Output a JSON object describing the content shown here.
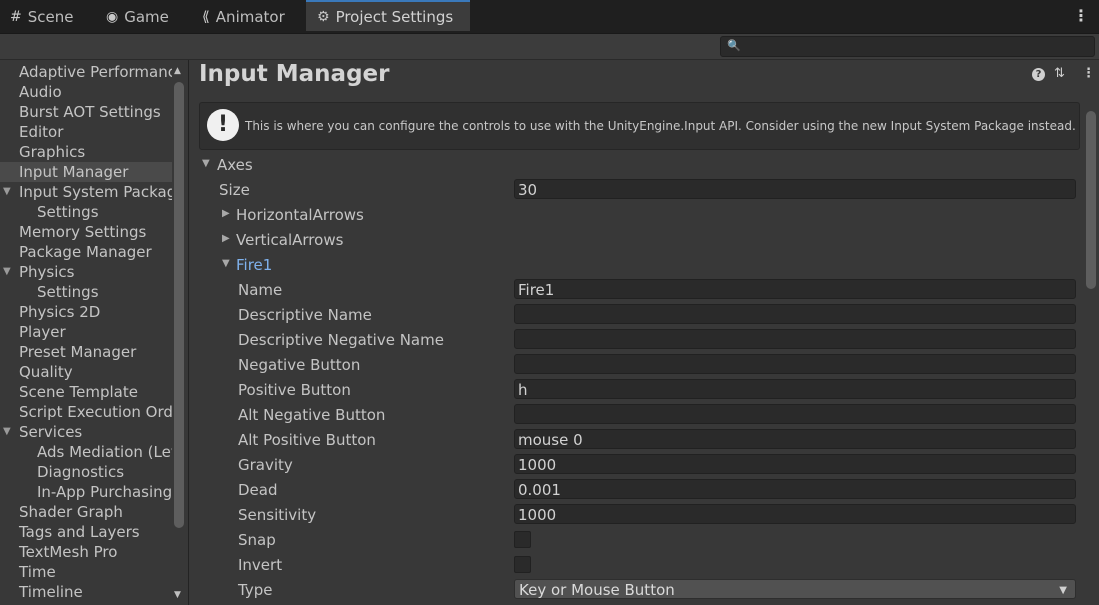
{
  "tabs": [
    {
      "label": "Scene",
      "icon": "grid-icon"
    },
    {
      "label": "Game",
      "icon": "gamepad-icon"
    },
    {
      "label": "Animator",
      "icon": "animator-icon"
    },
    {
      "label": "Project Settings",
      "icon": "gear-icon"
    }
  ],
  "search": {
    "placeholder": "",
    "value": ""
  },
  "sidebar": {
    "items": [
      {
        "label": "Adaptive Performance"
      },
      {
        "label": "Audio"
      },
      {
        "label": "Burst AOT Settings"
      },
      {
        "label": "Editor"
      },
      {
        "label": "Graphics"
      },
      {
        "label": "Input Manager",
        "selected": true
      },
      {
        "label": "Input System Package",
        "expanded": true
      },
      {
        "label": "Settings"
      },
      {
        "label": "Memory Settings"
      },
      {
        "label": "Package Manager"
      },
      {
        "label": "Physics",
        "expanded": true
      },
      {
        "label": "Settings"
      },
      {
        "label": "Physics 2D"
      },
      {
        "label": "Player"
      },
      {
        "label": "Preset Manager"
      },
      {
        "label": "Quality"
      },
      {
        "label": "Scene Template"
      },
      {
        "label": "Script Execution Order"
      },
      {
        "label": "Services",
        "expanded": true
      },
      {
        "label": "Ads Mediation (LevelPlay)"
      },
      {
        "label": "Diagnostics"
      },
      {
        "label": "In-App Purchasing"
      },
      {
        "label": "Shader Graph"
      },
      {
        "label": "Tags and Layers"
      },
      {
        "label": "TextMesh Pro"
      },
      {
        "label": "Time"
      },
      {
        "label": "Timeline"
      }
    ]
  },
  "main": {
    "title": "Input Manager",
    "notice": "This is where you can configure the controls to use with the UnityEngine.Input API. Consider using the new Input System Package instead.",
    "axes_label": "Axes",
    "size_label": "Size",
    "size_value": "30",
    "children": [
      "HorizontalArrows",
      "VerticalArrows"
    ],
    "fire1": {
      "label": "Fire1",
      "fields": [
        {
          "label": "Name",
          "value": "Fire1"
        },
        {
          "label": "Descriptive Name",
          "value": ""
        },
        {
          "label": "Descriptive Negative Name",
          "value": ""
        },
        {
          "label": "Negative Button",
          "value": ""
        },
        {
          "label": "Positive Button",
          "value": "h"
        },
        {
          "label": "Alt Negative Button",
          "value": ""
        },
        {
          "label": "Alt Positive Button",
          "value": "mouse 0"
        },
        {
          "label": "Gravity",
          "value": "1000"
        },
        {
          "label": "Dead",
          "value": "0.001"
        },
        {
          "label": "Sensitivity",
          "value": "1000"
        }
      ],
      "snap_label": "Snap",
      "snap_checked": false,
      "invert_label": "Invert",
      "invert_checked": false,
      "type_label": "Type",
      "type_value": "Key or Mouse Button"
    }
  },
  "colors": {
    "accent": "#3a79bb",
    "selected_label": "#7fb1ec",
    "background": "#383838"
  }
}
